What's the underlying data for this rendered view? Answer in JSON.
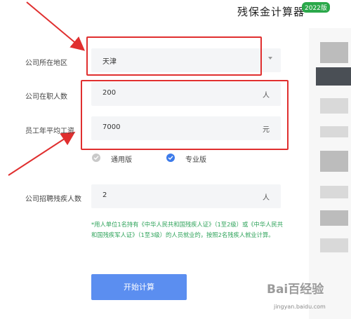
{
  "header": {
    "title": "残保金计算器",
    "version_badge": "2022版"
  },
  "form": {
    "region": {
      "label": "公司所在地区",
      "value": "天津"
    },
    "employees": {
      "label": "公司在职人数",
      "value": "200",
      "unit": "人"
    },
    "avg_salary": {
      "label": "员工年平均工资",
      "value": "7000",
      "unit": "元"
    },
    "edition": {
      "options": [
        {
          "label": "通用版",
          "selected": false
        },
        {
          "label": "专业版",
          "selected": true
        }
      ]
    },
    "disabled_hires": {
      "label": "公司招聘残疾人数",
      "value": "2",
      "unit": "人"
    }
  },
  "note": "*用人单位1名持有《中华人民共和国残疾人证》（1至2级）或《中华人民共和国残疾军人证》（1至3级）的人员就业的，按照2名残疾人就业计算。",
  "actions": {
    "start_label": "开始计算"
  },
  "watermark": {
    "text": "Bai百经验",
    "url": "jingyan.baidu.com"
  },
  "colors": {
    "accent": "#5b8ef0",
    "highlight": "#e02f2f",
    "note": "#2ea35a",
    "badge": "#2aa84a"
  }
}
